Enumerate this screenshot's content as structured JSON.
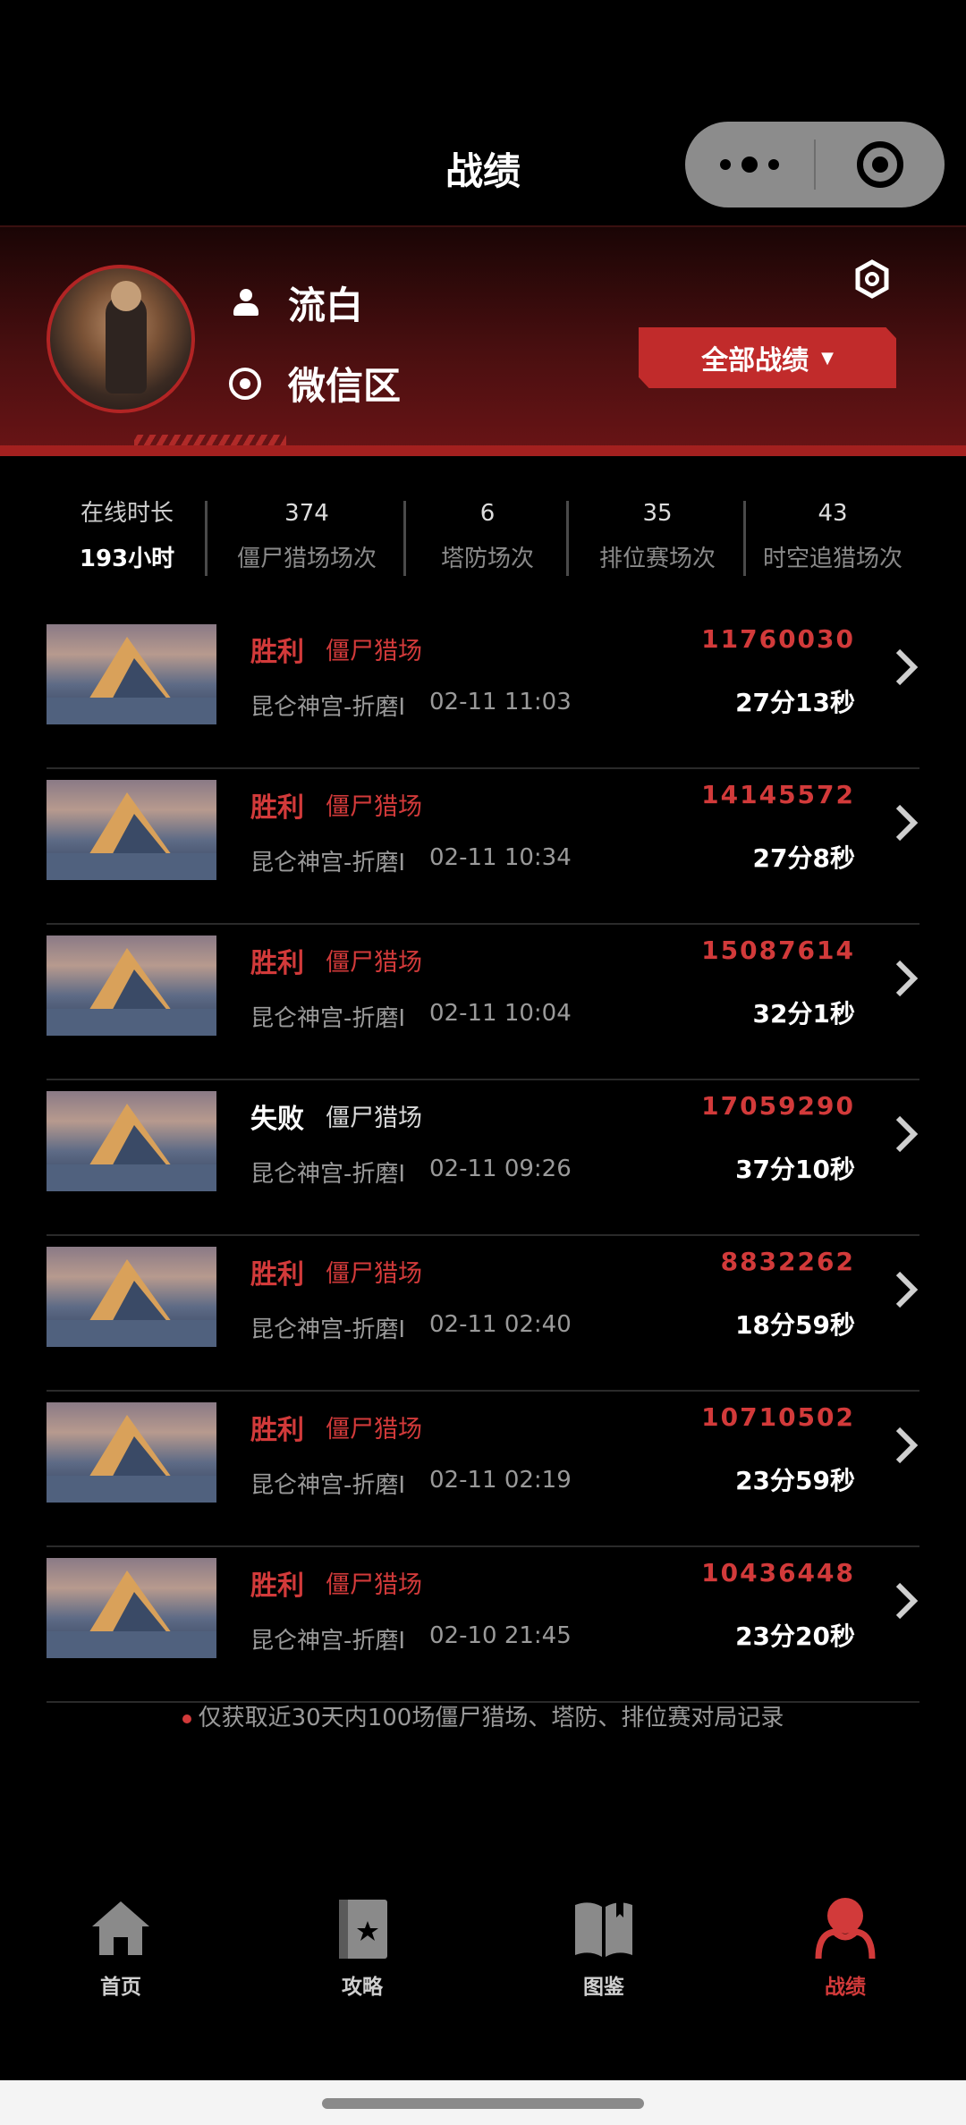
{
  "header": {
    "title": "战绩"
  },
  "profile": {
    "name": "流白",
    "zone": "微信区",
    "filter_label": "全部战绩",
    "filter_arrow": "▼"
  },
  "stats": [
    {
      "value": "在线时长",
      "label": "193小时"
    },
    {
      "value": "374",
      "label": "僵尸猎场场次"
    },
    {
      "value": "6",
      "label": "塔防场次"
    },
    {
      "value": "35",
      "label": "排位赛场次"
    },
    {
      "value": "43",
      "label": "时空追猎场次"
    }
  ],
  "records": [
    {
      "result": "胜利",
      "outcome": "win",
      "mode": "僵尸猎场",
      "map": "昆仑神宫-折磨I",
      "time": "02-11 11:03",
      "score": "11760030",
      "duration": "27分13秒"
    },
    {
      "result": "胜利",
      "outcome": "win",
      "mode": "僵尸猎场",
      "map": "昆仑神宫-折磨I",
      "time": "02-11 10:34",
      "score": "14145572",
      "duration": "27分8秒"
    },
    {
      "result": "胜利",
      "outcome": "win",
      "mode": "僵尸猎场",
      "map": "昆仑神宫-折磨I",
      "time": "02-11 10:04",
      "score": "15087614",
      "duration": "32分1秒"
    },
    {
      "result": "失败",
      "outcome": "lose",
      "mode": "僵尸猎场",
      "map": "昆仑神宫-折磨I",
      "time": "02-11 09:26",
      "score": "17059290",
      "duration": "37分10秒"
    },
    {
      "result": "胜利",
      "outcome": "win",
      "mode": "僵尸猎场",
      "map": "昆仑神宫-折磨I",
      "time": "02-11 02:40",
      "score": "8832262",
      "duration": "18分59秒"
    },
    {
      "result": "胜利",
      "outcome": "win",
      "mode": "僵尸猎场",
      "map": "昆仑神宫-折磨I",
      "time": "02-11 02:19",
      "score": "10710502",
      "duration": "23分59秒"
    },
    {
      "result": "胜利",
      "outcome": "win",
      "mode": "僵尸猎场",
      "map": "昆仑神宫-折磨I",
      "time": "02-10 21:45",
      "score": "10436448",
      "duration": "23分20秒"
    }
  ],
  "notice": "仅获取近30天内100场僵尸猎场、塔防、排位赛对局记录",
  "tabs": [
    {
      "label": "首页",
      "icon": "home-icon",
      "active": false
    },
    {
      "label": "攻略",
      "icon": "guide-book-icon",
      "active": false
    },
    {
      "label": "图鉴",
      "icon": "open-book-icon",
      "active": false
    },
    {
      "label": "战绩",
      "icon": "profile-icon",
      "active": true
    }
  ],
  "colors": {
    "accent": "#d23a3a",
    "button": "#c12b2b",
    "background": "#000000"
  }
}
